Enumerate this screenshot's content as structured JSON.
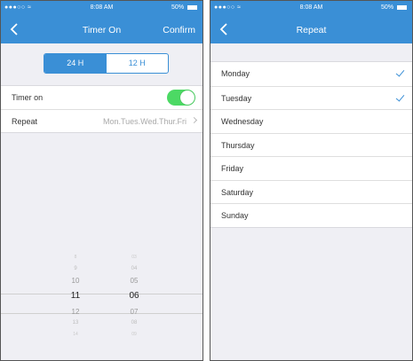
{
  "colors": {
    "accent": "#3a8fd6",
    "toggle_on": "#4cd964",
    "background": "#efeff4"
  },
  "left_screen": {
    "status": {
      "signal": "●●●○○ ≈",
      "time": "8:08 AM",
      "battery": "50%"
    },
    "nav": {
      "back_icon": "chevron-left-icon",
      "title": "Timer On",
      "confirm": "Confirm"
    },
    "segment": {
      "options": [
        "24 H",
        "12 H"
      ],
      "selected": "24 H"
    },
    "timer_on": {
      "label": "Timer on",
      "enabled": true
    },
    "repeat": {
      "label": "Repeat",
      "value": "Mon.Tues.Wed.Thur.Fri"
    },
    "picker": {
      "hours": [
        "8",
        "9",
        "10",
        "11",
        "12",
        "13",
        "14"
      ],
      "minutes": [
        "03",
        "04",
        "05",
        "06",
        "07",
        "08",
        "09"
      ],
      "selected_hour": "11",
      "selected_minute": "06"
    }
  },
  "right_screen": {
    "status": {
      "signal": "●●●○○ ≈",
      "time": "8:08 AM",
      "battery": "50%"
    },
    "nav": {
      "back_icon": "chevron-left-icon",
      "title": "Repeat"
    },
    "days": [
      {
        "label": "Monday",
        "checked": true
      },
      {
        "label": "Tuesday",
        "checked": true
      },
      {
        "label": "Wednesday",
        "checked": false
      },
      {
        "label": "Thursday",
        "checked": false
      },
      {
        "label": "Friday",
        "checked": false
      },
      {
        "label": "Saturday",
        "checked": false
      },
      {
        "label": "Sunday",
        "checked": false
      }
    ]
  }
}
